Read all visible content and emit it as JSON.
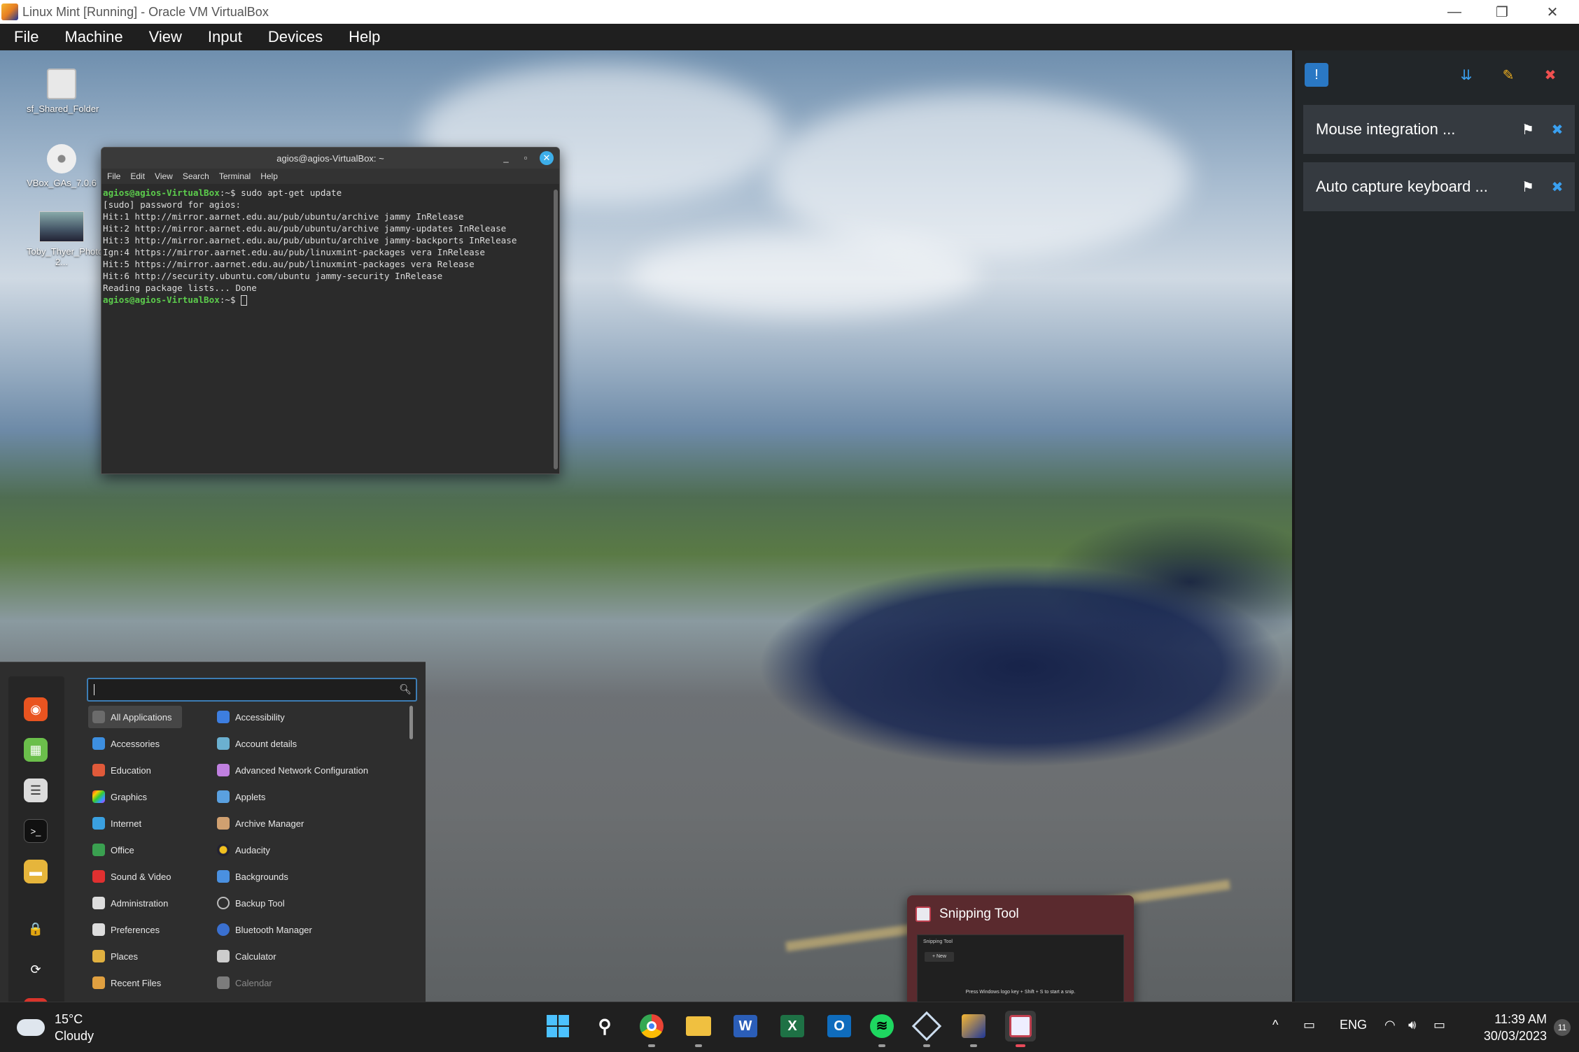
{
  "window": {
    "title": "Linux Mint [Running] - Oracle VM VirtualBox",
    "minimize": "—",
    "restore": "❐",
    "close": "✕"
  },
  "vb_menu": [
    "File",
    "Machine",
    "View",
    "Input",
    "Devices",
    "Help"
  ],
  "desktop_icons": [
    {
      "label": "sf_Shared_Folder",
      "icon": "drive-icon"
    },
    {
      "label": "VBox_GAs_7.0.6",
      "icon": "disc-icon"
    },
    {
      "label": "Toby_Thyer_Photographer-2...",
      "icon": "image-thumbnail"
    }
  ],
  "terminal": {
    "title": "agios@agios-VirtualBox: ~",
    "menu": [
      "File",
      "Edit",
      "View",
      "Search",
      "Terminal",
      "Help"
    ],
    "prompt": "agios@agios-VirtualBox",
    "prompt_suffix": ":~$ ",
    "command": "sudo apt-get update",
    "lines": [
      "[sudo] password for agios:",
      "Hit:1 http://mirror.aarnet.edu.au/pub/ubuntu/archive jammy InRelease",
      "Hit:2 http://mirror.aarnet.edu.au/pub/ubuntu/archive jammy-updates InRelease",
      "Hit:3 http://mirror.aarnet.edu.au/pub/ubuntu/archive jammy-backports InRelease",
      "Ign:4 https://mirror.aarnet.edu.au/pub/linuxmint-packages vera InRelease",
      "Hit:5 https://mirror.aarnet.edu.au/pub/linuxmint-packages vera Release",
      "Hit:6 http://security.ubuntu.com/ubuntu jammy-security InRelease",
      "Reading package lists... Done"
    ]
  },
  "mint_menu": {
    "search_value": "",
    "categories": [
      {
        "label": "All Applications",
        "color": "#6b6b6b",
        "selected": true
      },
      {
        "label": "Accessories",
        "color": "#3d8fe0"
      },
      {
        "label": "Education",
        "color": "#e05a3a"
      },
      {
        "label": "Graphics",
        "color": "#c040c0"
      },
      {
        "label": "Internet",
        "color": "#3aa0e0"
      },
      {
        "label": "Office",
        "color": "#3aa050"
      },
      {
        "label": "Sound & Video",
        "color": "#e03030"
      },
      {
        "label": "Administration",
        "color": "#dddddd"
      },
      {
        "label": "Preferences",
        "color": "#dddddd"
      },
      {
        "label": "Places",
        "color": "#e0b040"
      },
      {
        "label": "Recent Files",
        "color": "#e0a040"
      }
    ],
    "apps": [
      {
        "label": "Accessibility",
        "color": "#3d7ee0"
      },
      {
        "label": "Account details",
        "color": "#6bb0d0"
      },
      {
        "label": "Advanced Network Configuration",
        "color": "#c080e0"
      },
      {
        "label": "Applets",
        "color": "#5aa0e0"
      },
      {
        "label": "Archive Manager",
        "color": "#d0a070"
      },
      {
        "label": "Audacity",
        "color": "#f0c020"
      },
      {
        "label": "Backgrounds",
        "color": "#4a90e0"
      },
      {
        "label": "Backup Tool",
        "color": "#bbbbbb"
      },
      {
        "label": "Bluetooth Manager",
        "color": "#3a70d0"
      },
      {
        "label": "Calculator",
        "color": "#cccccc"
      },
      {
        "label": "Calendar",
        "color": "#b0b0b0",
        "dim": true
      }
    ]
  },
  "vb_sidebar": {
    "notifications": [
      {
        "text": "Mouse integration ..."
      },
      {
        "text": "Auto capture keyboard ..."
      }
    ]
  },
  "snipping_preview": {
    "title": "Snipping Tool",
    "inner_title": "Snipping Tool",
    "new_label": "+ New",
    "hint": "Press Windows logo key + Shift + S to start a snip."
  },
  "taskbar": {
    "temperature": "15°C",
    "condition": "Cloudy",
    "language": "ENG",
    "time": "11:39 AM",
    "date": "30/03/2023",
    "notification_count": "11",
    "chevron": "^"
  }
}
